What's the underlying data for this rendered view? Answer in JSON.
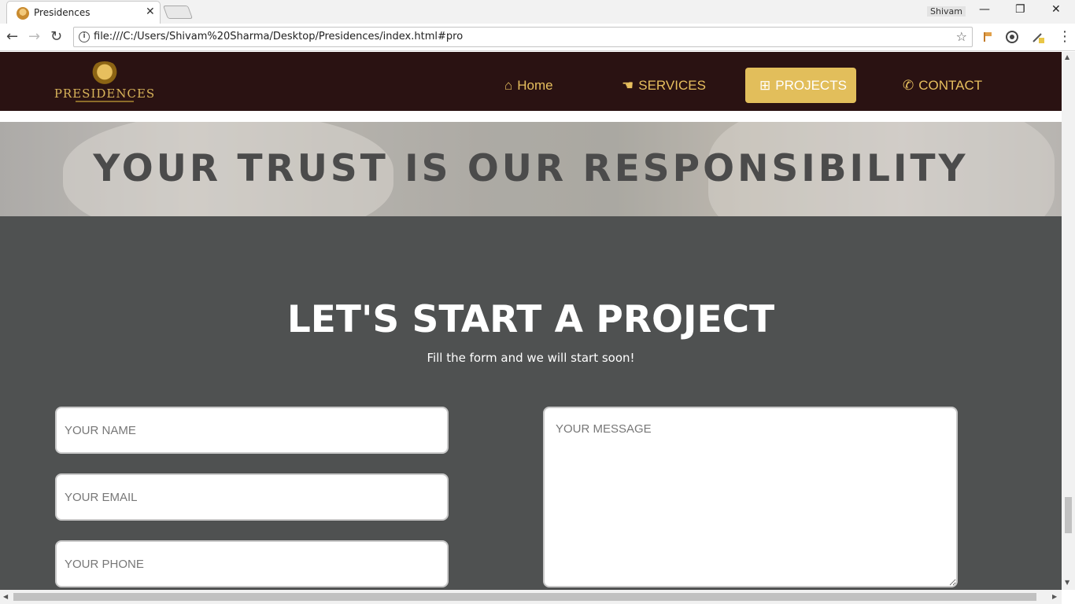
{
  "browser": {
    "tab_title": "Presidences",
    "tab_close": "✕",
    "profile_name": "Shivam",
    "url": "file:///C:/Users/Shivam%20Sharma/Desktop/Presidences/index.html#pro",
    "window_controls": {
      "minimize": "—",
      "maximize": "❐",
      "close": "✕"
    },
    "nav": {
      "back": "←",
      "forward": "→",
      "reload": "↻"
    },
    "star": "☆",
    "menu": "⋮"
  },
  "site": {
    "logo_text": "PRESIDENCES",
    "nav_items": [
      {
        "label": "Home",
        "icon": "⌂",
        "icon_name": "home-icon"
      },
      {
        "label": "SERVICES",
        "icon": "☚",
        "icon_name": "handshake-icon"
      },
      {
        "label": "PROJECTS",
        "icon": "⊞",
        "icon_name": "sitemap-icon",
        "active": true
      },
      {
        "label": "CONTACT",
        "icon": "✆",
        "icon_name": "phone-icon"
      }
    ]
  },
  "hero": {
    "title": "YOUR TRUST IS OUR RESPONSIBILITY"
  },
  "contact": {
    "title": "LET'S START A PROJECT",
    "subtitle": "Fill the form and we will start soon!",
    "name_placeholder": "YOUR NAME",
    "email_placeholder": "YOUR EMAIL",
    "phone_placeholder": "YOUR PHONE",
    "message_placeholder": "YOUR MESSAGE"
  },
  "colors": {
    "nav_bg": "#2a1212",
    "gold": "#e7bf5e",
    "active_bg": "#e2be5b",
    "section_bg": "#4f5151"
  }
}
